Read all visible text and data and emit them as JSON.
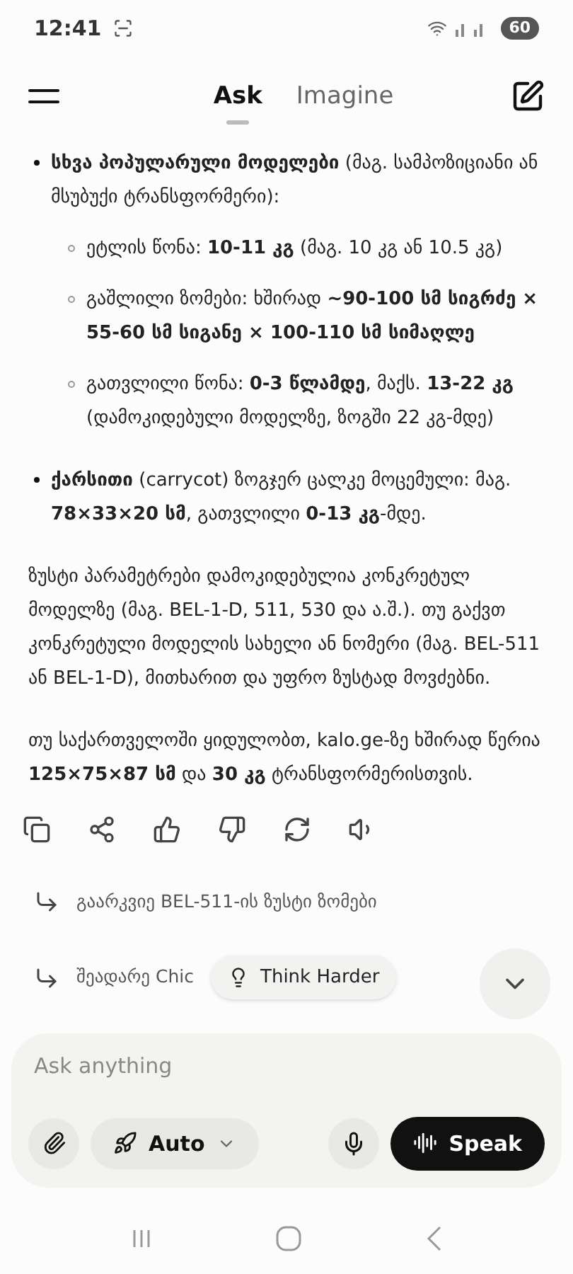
{
  "status_bar": {
    "time": "12:41",
    "battery": "60"
  },
  "header": {
    "tabs": [
      {
        "label": "Ask",
        "selected": true
      },
      {
        "label": "Imagine",
        "selected": false
      }
    ]
  },
  "answer": {
    "blocks": [
      {
        "kind": "bullet",
        "text": "**სხვა პოპულარული მოდელები** (მაგ. სამპოზიციანი ან მსუბუქი ტრანსფორმერი):",
        "children": [
          {
            "text": "ეტლის წონა: **10-11 კგ** (მაგ. 10 კგ ან 10.5 კგ)"
          },
          {
            "text": "გაშლილი ზომები: ხშირად **~90-100 სმ სიგრძე × 55-60 სმ სიგანე × 100-110 სმ სიმაღლე**"
          },
          {
            "text": "გათვლილი წონა: **0-3 წლამდე**, მაქს. **13-22 კგ** (დამოკიდებული მოდელზე, ზოგში 22 კგ-მდე)"
          }
        ]
      },
      {
        "kind": "bullet",
        "text": "**ქარსითი** (carrycot) ზოგჯერ ცალკე მოცემული: მაგ. **78×33×20 სმ**, გათვლილი **0-13 კგ**-მდე."
      },
      {
        "kind": "paragraph",
        "text": "ზუსტი პარამეტრები დამოკიდებულია კონკრეტულ მოდელზე (მაგ. BEL-1-D, 511, 530 და ა.შ.). თუ გაქვთ კონკრეტული მოდელის სახელი ან ნომერი (მაგ. BEL-511 ან BEL-1-D), მითხარით და უფრო ზუსტად მოვძებნი."
      },
      {
        "kind": "paragraph",
        "text": "თუ საქართველოში ყიდულობთ, kalo.ge-ზე ხშირად წერია **125×75×87 სმ** და **30 კგ** ტრანსფორმერისთვის."
      }
    ]
  },
  "suggestions": [
    "გაარკვიე BEL-511-ის ზუსტი ზომები",
    "შეადარე Chic"
  ],
  "think_button": "Think Harder",
  "composer": {
    "placeholder": "Ask anything",
    "mode": "Auto",
    "speak": "Speak"
  }
}
